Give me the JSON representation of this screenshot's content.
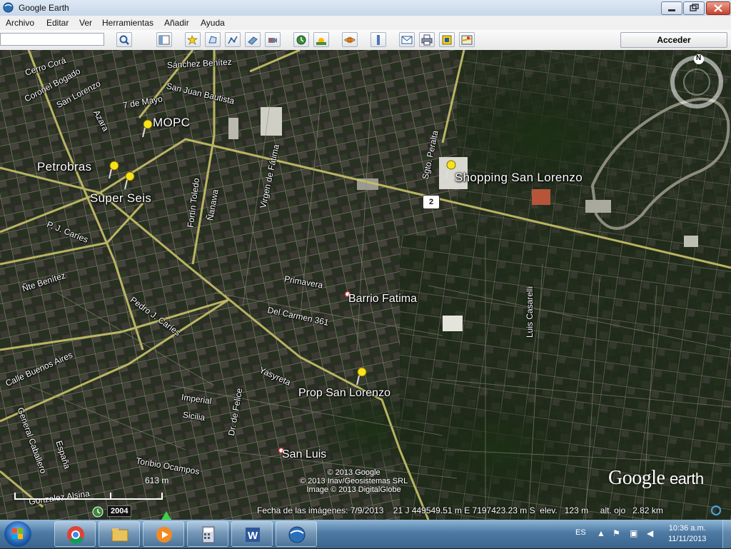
{
  "window": {
    "title": "Google Earth"
  },
  "menu": [
    "Archivo",
    "Editar",
    "Ver",
    "Herramientas",
    "Añadir",
    "Ayuda"
  ],
  "toolbar": {
    "search_value": "",
    "signin_label": "Acceder",
    "icons": [
      "search-icon",
      "sidebar-toggle-icon",
      "add-placemark-icon",
      "add-polygon-icon",
      "add-path-icon",
      "add-image-overlay-icon",
      "record-tour-icon",
      "historical-imagery-icon",
      "sunlight-icon",
      "planets-icon",
      "ruler-icon",
      "email-icon",
      "print-icon",
      "save-image-icon",
      "view-in-maps-icon"
    ]
  },
  "map": {
    "streets": [
      {
        "text": "Cerro Corá"
      },
      {
        "text": "Coronel Bogado"
      },
      {
        "text": "San Lorenzo"
      },
      {
        "text": "Azara"
      },
      {
        "text": "7 de Mayo"
      },
      {
        "text": "Sánchez Benítez"
      },
      {
        "text": "San Juan Bautista"
      },
      {
        "text": "Fortín Toledo"
      },
      {
        "text": "Ñanawa"
      },
      {
        "text": "Virgen de Fátima"
      },
      {
        "text": "Sgto. Peralta"
      },
      {
        "text": "P. J. Caríes"
      },
      {
        "text": "Primavera"
      },
      {
        "text": "Del Carmen 361"
      },
      {
        "text": "Ñte Benítez"
      },
      {
        "text": "Pedro J. Caríes"
      },
      {
        "text": "Calle Buenos Aires"
      },
      {
        "text": "Yasyreta"
      },
      {
        "text": "Imperial"
      },
      {
        "text": "Sicilia"
      },
      {
        "text": "Dr. de Felice"
      },
      {
        "text": "General Caballero"
      },
      {
        "text": "España"
      },
      {
        "text": "Toribio Ocampos"
      },
      {
        "text": "Gonzalez Alsina"
      },
      {
        "text": "Luis Casarelli"
      }
    ],
    "places": [
      {
        "text": "MOPC"
      },
      {
        "text": "Petrobras"
      },
      {
        "text": "Super Seis"
      },
      {
        "text": "Shopping San Lorenzo"
      },
      {
        "text": "Barrio Fatima"
      },
      {
        "text": "Prop San Lorenzo"
      },
      {
        "text": "San Luis"
      }
    ],
    "route_shield": "2",
    "credits": [
      "© 2013 Google",
      "© 2013 Inav/Geosistemas SRL",
      "Image © 2013 DigitalGlobe"
    ],
    "logo": {
      "brand": "Google",
      "product": "earth"
    },
    "scale_label": "613 m",
    "year": "2004",
    "compass_label": "N",
    "status": {
      "imagery_date": "Fecha de las imágenes: 7/9/2013",
      "coords": "21 J 449549.51 m E 7197423.23 m S",
      "elevation": "elev.   123 m",
      "eye_alt": "alt. ojo   2.82 km"
    }
  },
  "taskbar": {
    "apps": [
      "chrome-icon",
      "explorer-folder-icon",
      "media-player-icon",
      "calculator-icon",
      "word-icon",
      "google-earth-icon"
    ],
    "lang": "ES",
    "time": "10:36 a.m.",
    "date": "11/11/2013"
  }
}
